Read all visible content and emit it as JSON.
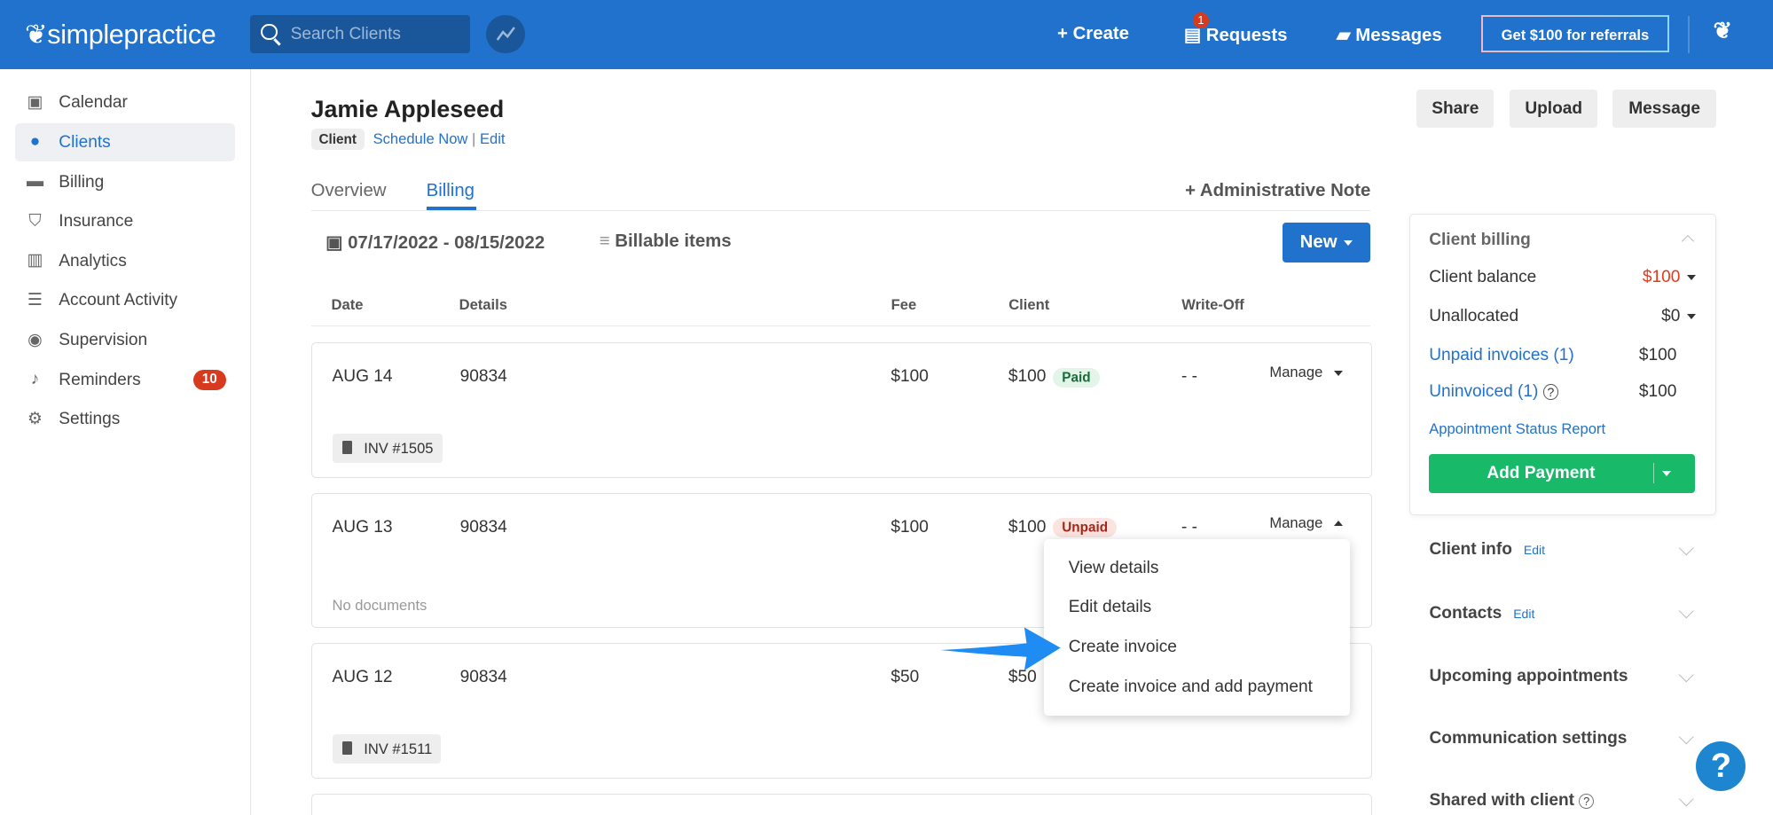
{
  "topbar": {
    "logo": "simplepractice",
    "search_placeholder": "Search Clients",
    "create": "+ Create",
    "requests": "Requests",
    "requests_badge": "1",
    "messages": "Messages",
    "referral": "Get $100 for referrals"
  },
  "sidebar": {
    "items": [
      {
        "label": "Calendar",
        "icon": "calendar-icon"
      },
      {
        "label": "Clients",
        "icon": "users-icon",
        "active": true
      },
      {
        "label": "Billing",
        "icon": "card-icon"
      },
      {
        "label": "Insurance",
        "icon": "shield-icon"
      },
      {
        "label": "Analytics",
        "icon": "chart-icon"
      },
      {
        "label": "Account Activity",
        "icon": "list-icon"
      },
      {
        "label": "Supervision",
        "icon": "eye-icon"
      },
      {
        "label": "Reminders",
        "icon": "bell-icon",
        "badge": "10"
      },
      {
        "label": "Settings",
        "icon": "gear-icon"
      }
    ]
  },
  "client": {
    "name": "Jamie Appleseed",
    "tag": "Client",
    "schedule": "Schedule Now",
    "sep": "|",
    "edit": "Edit"
  },
  "actions": {
    "share": "Share",
    "upload": "Upload",
    "message": "Message"
  },
  "tabs": {
    "overview": "Overview",
    "billing": "Billing",
    "admin_note": "+ Administrative Note"
  },
  "filters": {
    "date_range": "07/17/2022 - 08/15/2022",
    "billable": "Billable items",
    "new": "New"
  },
  "table": {
    "headers": [
      "Date",
      "Details",
      "Fee",
      "Client",
      "Write-Off"
    ],
    "rows": [
      {
        "date": "AUG 14",
        "details": "90834",
        "fee": "$100",
        "client": "$100",
        "status": "Paid",
        "writeoff": "- -",
        "manage": "Manage",
        "doc": "INV #1505"
      },
      {
        "date": "AUG 13",
        "details": "90834",
        "fee": "$100",
        "client": "$100",
        "status": "Unpaid",
        "writeoff": "- -",
        "manage": "Manage",
        "doc": "No documents"
      },
      {
        "date": "AUG 12",
        "details": "90834",
        "fee": "$50",
        "client": "$50",
        "doc": "INV #1511"
      }
    ]
  },
  "menu": {
    "items": [
      "View details",
      "Edit details",
      "Create invoice",
      "Create invoice and add payment"
    ]
  },
  "billing_panel": {
    "title": "Client billing",
    "balance_label": "Client balance",
    "balance": "$100",
    "unallocated_label": "Unallocated",
    "unallocated": "$0",
    "unpaid_label": "Unpaid invoices (1)",
    "unpaid": "$100",
    "uninvoiced_label": "Uninvoiced (1)",
    "uninvoiced": "$100",
    "report": "Appointment Status Report",
    "add_payment": "Add Payment"
  },
  "sections": {
    "client_info": "Client info",
    "contacts": "Contacts",
    "edit": "Edit",
    "upcoming": "Upcoming appointments",
    "communication": "Communication settings",
    "shared": "Shared with client"
  },
  "help": "?",
  "colors": {
    "brand": "#2172cc",
    "green": "#19b96a",
    "red": "#e8381a"
  }
}
